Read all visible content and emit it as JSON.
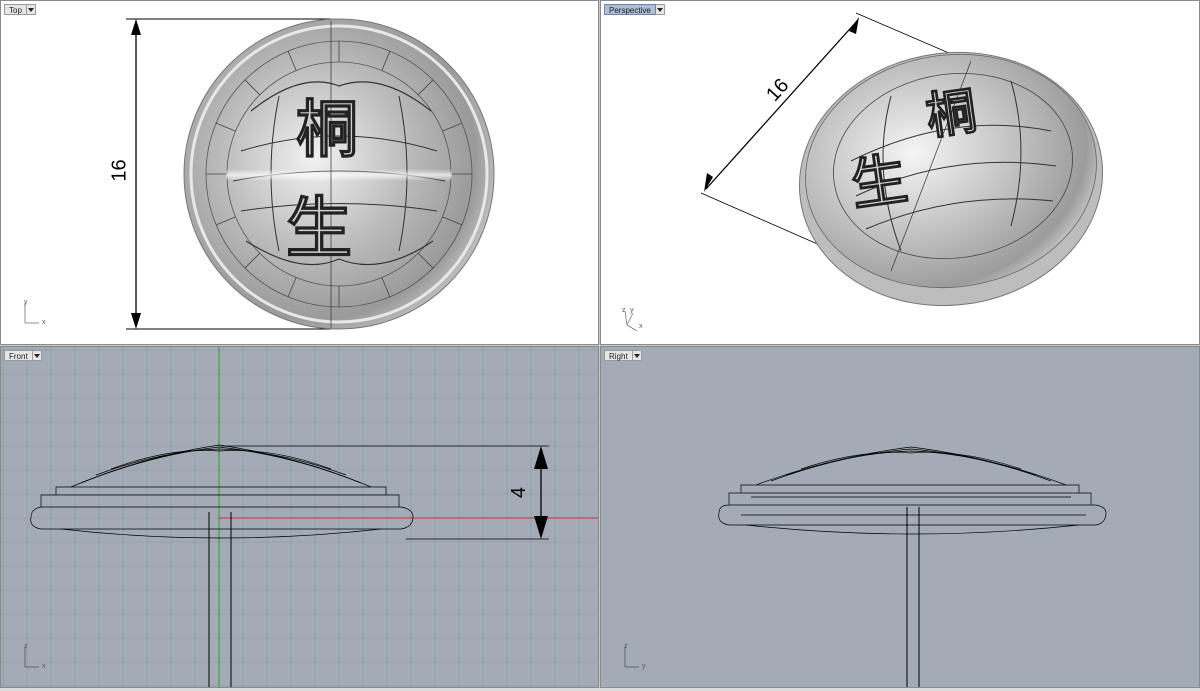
{
  "viewports": {
    "top": {
      "title": "Top",
      "dimension": "16",
      "axis_h": "x",
      "axis_v": "y"
    },
    "perspective": {
      "title": "Perspective",
      "dimension": "16",
      "axis_h": "x",
      "axis_v": "y",
      "axis_z": "z"
    },
    "front": {
      "title": "Front",
      "dimension": "4",
      "axis_h": "x",
      "axis_v": "z"
    },
    "right": {
      "title": "Right",
      "dimension": "",
      "axis_h": "y",
      "axis_v": "z"
    }
  },
  "colors": {
    "shaded_bg": "#ffffff",
    "wire_bg": "#a3acb6",
    "grid": "#8e97a1",
    "active_title": "#aebdd4",
    "x_axis": "#c83232",
    "y_axis": "#2e9a2e"
  },
  "icons": [
    "viewport-menu-arrow-icon",
    "world-axes-icon"
  ]
}
